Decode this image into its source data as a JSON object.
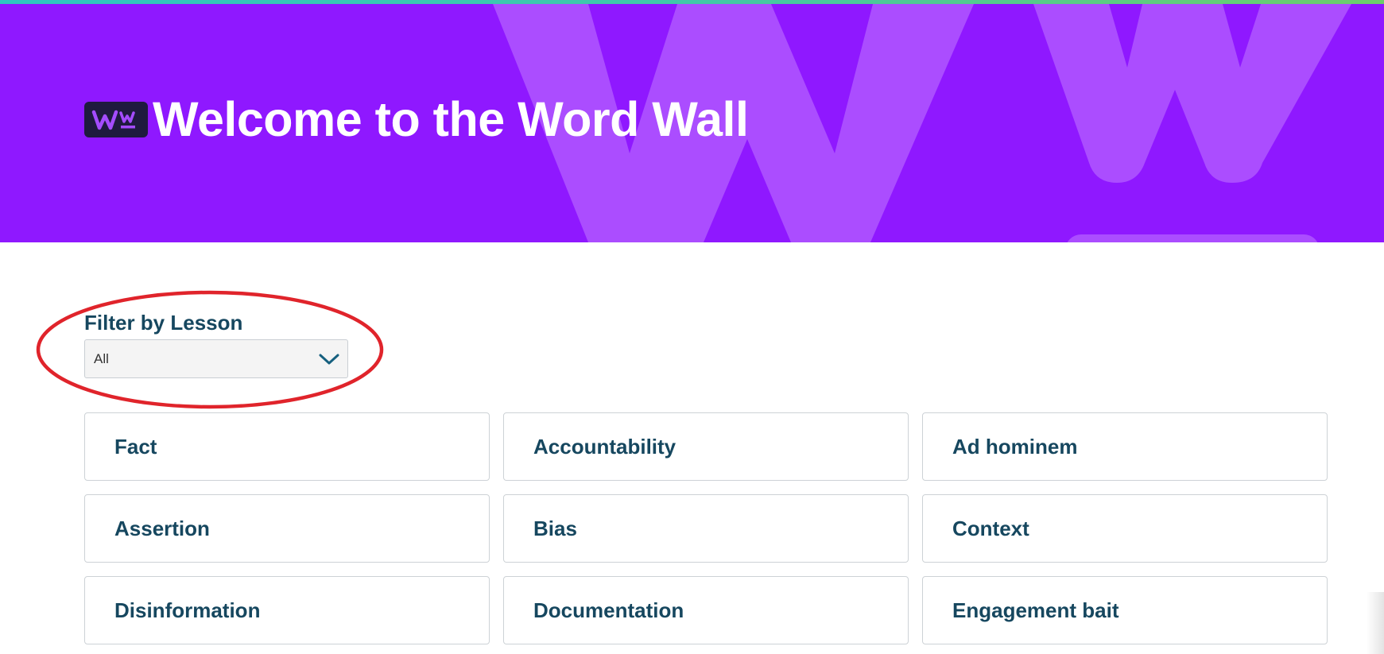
{
  "header": {
    "logo_text": "WW",
    "title": "Welcome to the Word Wall"
  },
  "colors": {
    "hero_background": "#8f18ff",
    "hero_decoration": "#ab4dff",
    "logo_badge": "#1f1a3f",
    "text_primary": "#16475f",
    "highlight_ring": "#e0242b",
    "top_stripe": "#41c8a8"
  },
  "filter": {
    "label": "Filter by Lesson",
    "selected": "All",
    "icon": "chevron-down-icon"
  },
  "terms": [
    {
      "label": "Fact"
    },
    {
      "label": "Accountability"
    },
    {
      "label": "Ad hominem"
    },
    {
      "label": "Assertion"
    },
    {
      "label": "Bias"
    },
    {
      "label": "Context"
    },
    {
      "label": "Disinformation"
    },
    {
      "label": "Documentation"
    },
    {
      "label": "Engagement bait"
    }
  ]
}
